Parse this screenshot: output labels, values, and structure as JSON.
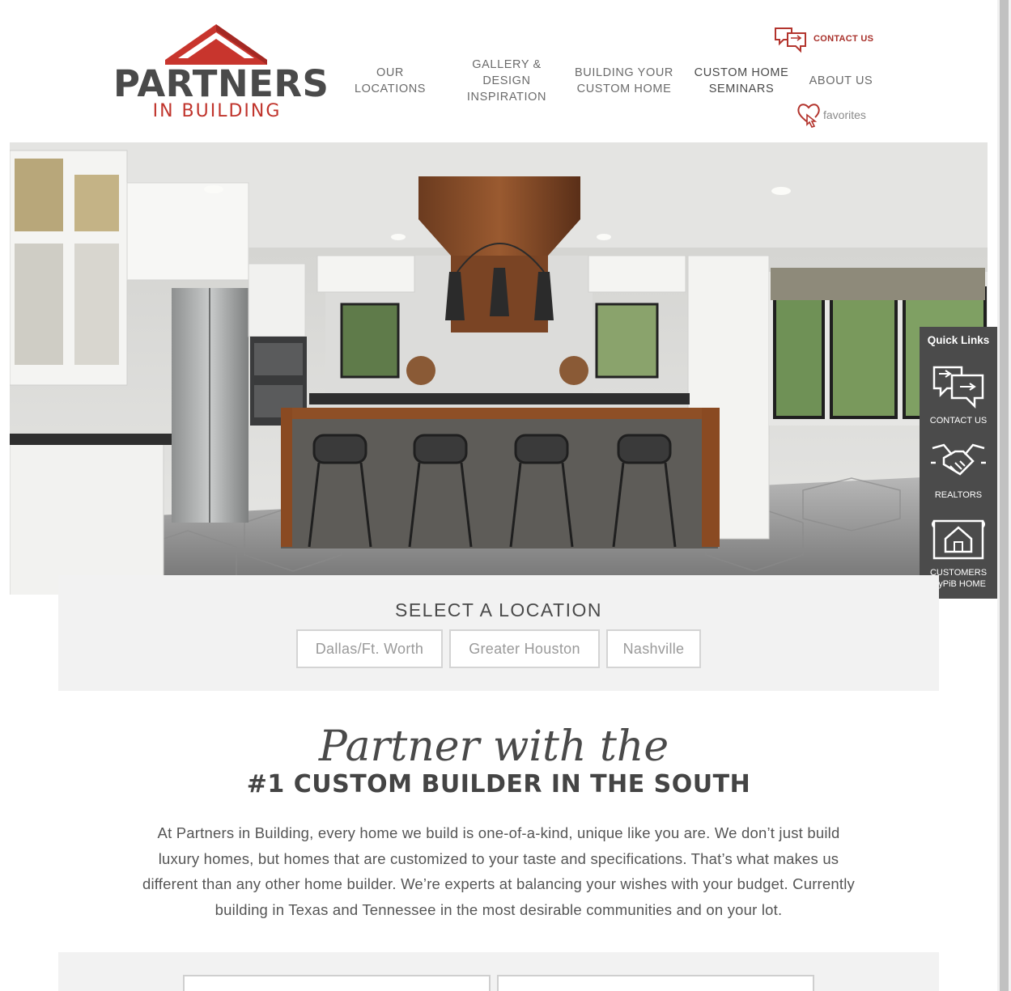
{
  "brand": {
    "name": "PARTNERS",
    "tagline": "IN BUILDING",
    "accent_color": "#c0342c",
    "text_color": "#4a4a4a"
  },
  "nav": {
    "items": [
      {
        "line1": "OUR",
        "line2": "LOCATIONS"
      },
      {
        "line1": "GALLERY &",
        "line2": "DESIGN",
        "line3": "INSPIRATION"
      },
      {
        "line1": "BUILDING YOUR",
        "line2": "CUSTOM HOME"
      },
      {
        "line1": "CUSTOM HOME",
        "line2": "SEMINARS"
      },
      {
        "line1": "ABOUT US"
      }
    ],
    "contact_label": "CONTACT US",
    "contact_icon": "chat-bubbles-icon",
    "favorites_label": "favorites",
    "favorites_icon": "heart-pointer-icon"
  },
  "quick_links": {
    "title": "Quick Links",
    "items": [
      {
        "label": "CONTACT US",
        "icon": "chat-bubbles-icon"
      },
      {
        "label": "REALTORS",
        "icon": "handshake-icon"
      },
      {
        "label_line1": "CUSTOMERS",
        "label_line2": "myPiB HOME",
        "icon": "house-blueprint-icon"
      }
    ]
  },
  "location_select": {
    "heading": "SELECT A LOCATION",
    "options": [
      "Dallas/Ft. Worth",
      "Greater Houston",
      "Nashville"
    ]
  },
  "intro": {
    "script_text": "Partner with the",
    "heading": "#1 CUSTOM BUILDER IN THE SOUTH",
    "line1": "At Partners in Building, every home we build is one-of-a-kind, unique like you are. We don’t just build",
    "line2": "luxury homes, but homes that are customized to your taste and specifications. That’s what makes us",
    "line3": "different than any other home builder. We’re experts at balancing your wishes with your budget. Currently",
    "line4": "building in Texas and Tennessee in the most desirable communities and on your lot."
  }
}
